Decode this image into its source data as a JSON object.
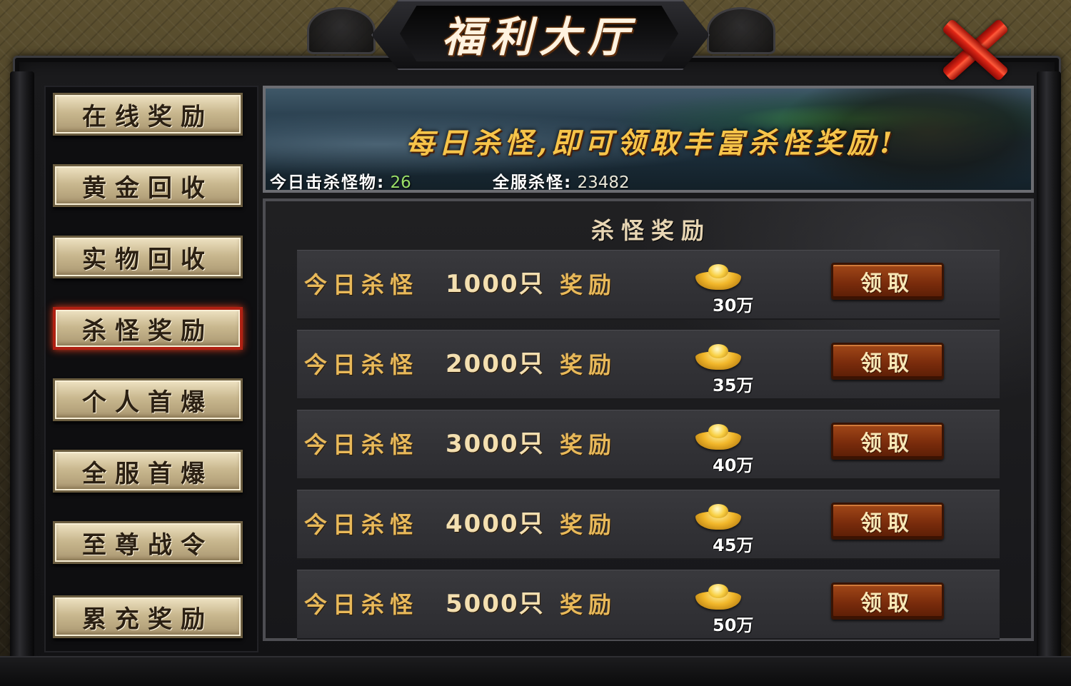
{
  "window": {
    "title": "福利大厅"
  },
  "nav": {
    "items": [
      {
        "label": "在线奖励",
        "active": false
      },
      {
        "label": "黄金回收",
        "active": false
      },
      {
        "label": "实物回收",
        "active": false
      },
      {
        "label": "杀怪奖励",
        "active": true
      },
      {
        "label": "个人首爆",
        "active": false
      },
      {
        "label": "全服首爆",
        "active": false
      },
      {
        "label": "至尊战令",
        "active": false
      },
      {
        "label": "累充奖励",
        "active": false
      }
    ]
  },
  "banner": {
    "slogan": "每日杀怪,即可领取丰富杀怪奖励!",
    "today_label": "今日击杀怪物:",
    "today_value": "26",
    "server_label": "全服杀怪:",
    "server_value": "23482"
  },
  "rewards": {
    "title": "杀怪奖励",
    "rows": [
      {
        "condition": "今日杀怪",
        "count": "1000只",
        "reward_label": "奖励",
        "amount": "30万",
        "button": "领取"
      },
      {
        "condition": "今日杀怪",
        "count": "2000只",
        "reward_label": "奖励",
        "amount": "35万",
        "button": "领取"
      },
      {
        "condition": "今日杀怪",
        "count": "3000只",
        "reward_label": "奖励",
        "amount": "40万",
        "button": "领取"
      },
      {
        "condition": "今日杀怪",
        "count": "4000只",
        "reward_label": "奖励",
        "amount": "45万",
        "button": "领取"
      },
      {
        "condition": "今日杀怪",
        "count": "5000只",
        "reward_label": "奖励",
        "amount": "50万",
        "button": "领取"
      }
    ]
  },
  "icons": {
    "close": "close-x-icon",
    "reward": "gold-ingot-icon"
  },
  "colors": {
    "active_nav_border": "#b02012",
    "gold_text": "#e8b95a",
    "close_red": "#e12716"
  }
}
